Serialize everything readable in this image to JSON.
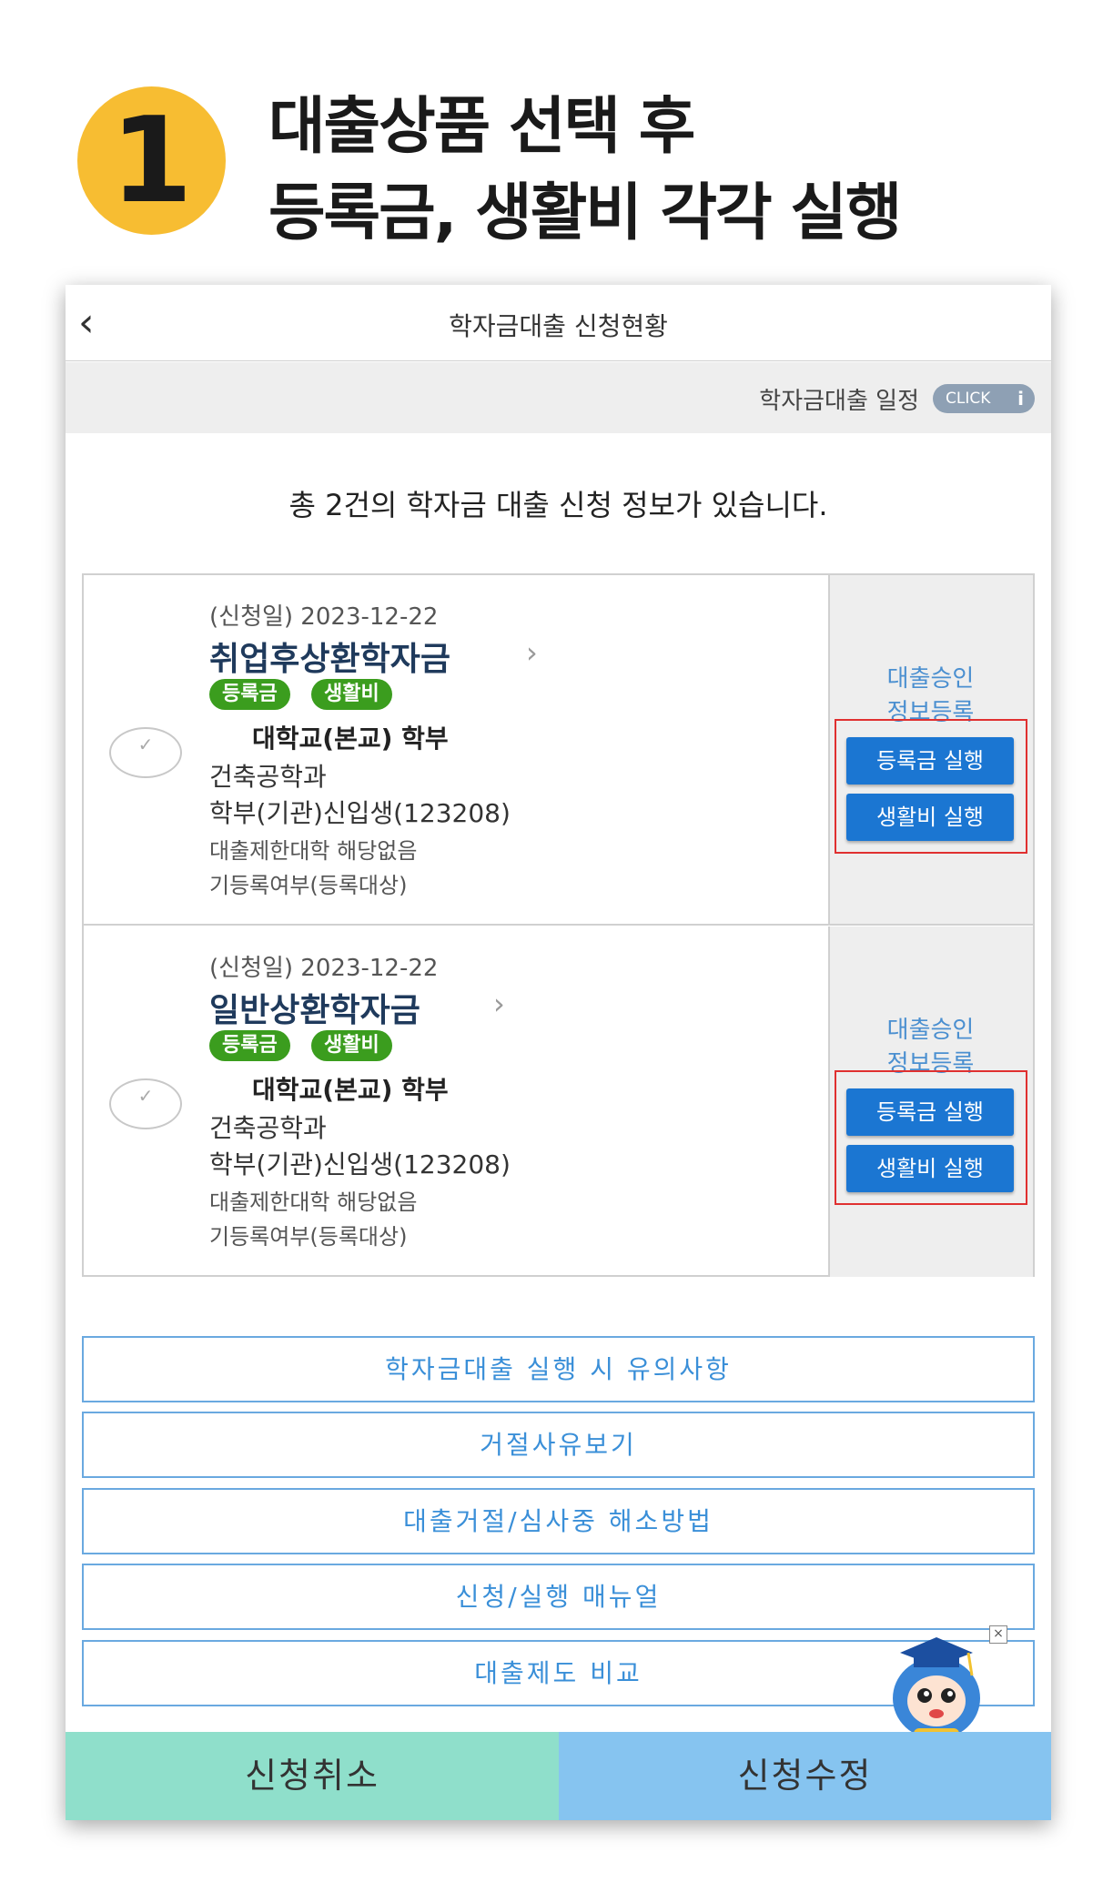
{
  "heading": {
    "step_number": "1",
    "line1": "대출상품 선택 후",
    "line2": "등록금, 생활비 각각 실행"
  },
  "topbar": {
    "title": "학자금대출 신청현황"
  },
  "schedule": {
    "label": "학자금대출 일정",
    "click_label": "CLICK",
    "info_glyph": "i"
  },
  "summary": "총 2건의 학자금 대출 신청 정보가 있습니다.",
  "cards": [
    {
      "apply_date": "(신청일) 2023-12-22",
      "loan_name": "취업후상환학자금",
      "badges": [
        "등록금",
        "생활비"
      ],
      "university": "대학교(본교) 학부",
      "department": "건축공학과",
      "student_info": "학부(기관)신입생(123208)",
      "restriction": "대출제한대학 해당없음",
      "registration": "기등록여부(등록대상)",
      "right_label_1": "대출승인",
      "right_label_2": "정보등록",
      "exec_tuition": "등록금 실행",
      "exec_living": "생활비 실행"
    },
    {
      "apply_date": "(신청일) 2023-12-22",
      "loan_name": "일반상환학자금",
      "badges": [
        "등록금",
        "생활비"
      ],
      "university": "대학교(본교) 학부",
      "department": "건축공학과",
      "student_info": "학부(기관)신입생(123208)",
      "restriction": "대출제한대학 해당없음",
      "registration": "기등록여부(등록대상)",
      "right_label_1": "대출승인",
      "right_label_2": "정보등록",
      "exec_tuition": "등록금 실행",
      "exec_living": "생활비 실행"
    }
  ],
  "links": [
    "학자금대출 실행 시 유의사항",
    "거절사유보기",
    "대출거절/심사중 해소방법",
    "신청/실행 매뉴얼",
    "대출제도 비교"
  ],
  "bottom": {
    "cancel": "신청취소",
    "edit": "신청수정"
  },
  "colors": {
    "accent_blue": "#1b76d2",
    "badge_green": "#3b9d1e",
    "step_yellow": "#f7bd32",
    "cancel_mint": "#8fdfcb",
    "edit_blue": "#86c4f0"
  }
}
